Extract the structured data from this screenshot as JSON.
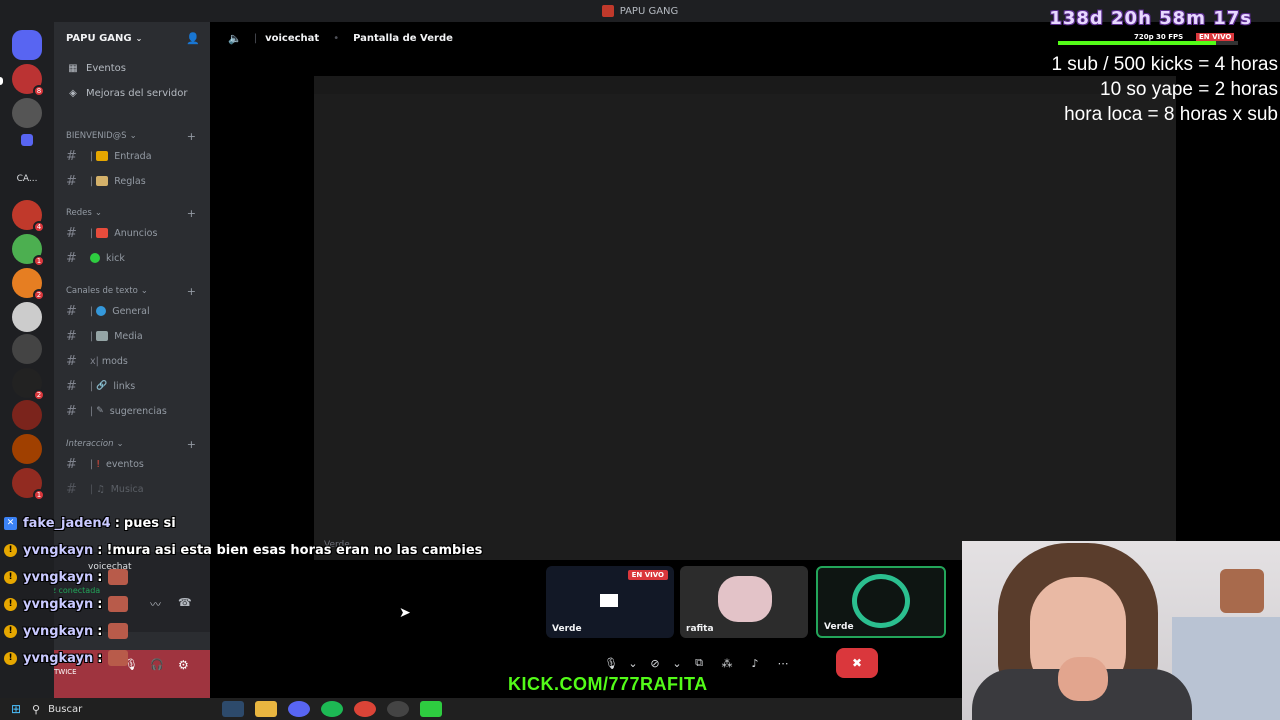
{
  "window": {
    "title": "PAPU GANG"
  },
  "server": {
    "name": "PAPU GANG",
    "top_items": [
      "Eventos",
      "Mejoras del servidor"
    ],
    "categories": [
      {
        "name": "BIENVENID@S",
        "channels": [
          "Entrada",
          "Reglas"
        ]
      },
      {
        "name": "Redes",
        "channels": [
          "Anuncios",
          "kick"
        ]
      },
      {
        "name": "Canales de texto",
        "channels": [
          "General",
          "Media",
          "mods",
          "links",
          "sugerencias"
        ]
      },
      {
        "name": "Interaccion",
        "channels": [
          "eventos",
          "Musica"
        ]
      }
    ],
    "rail": {
      "text_folder": "CA...",
      "badges": [
        "8",
        "",
        "4",
        "1",
        "2",
        "",
        "",
        "2",
        "",
        "",
        "1"
      ]
    }
  },
  "voice": {
    "channel": "voicechat",
    "screen_title": "Pantalla de Verde",
    "status": "Voz conectada",
    "user_label": "TWICE",
    "stream_tag": "Verde"
  },
  "tiles": [
    {
      "label": "Verde",
      "live": "EN VIVO"
    },
    {
      "label": "rafita"
    },
    {
      "label": "Verde"
    }
  ],
  "chat": [
    {
      "user": "fake_jaden4",
      "msg": "pues si",
      "badge": "blue"
    },
    {
      "user": "yvngkayn",
      "msg": "!mura asi esta bien esas horas eran no las cambies",
      "badge": "gold"
    },
    {
      "user": "yvngkayn",
      "msg": "",
      "badge": "gold"
    },
    {
      "user": "yvngkayn",
      "msg": "",
      "badge": "gold"
    },
    {
      "user": "yvngkayn",
      "msg": "",
      "badge": "gold"
    },
    {
      "user": "yvngkayn",
      "msg": "",
      "badge": "gold"
    }
  ],
  "overlay": {
    "timer": "138d 20h 58m 17s",
    "fps": "720p 30 FPS",
    "live": "EN VIVO",
    "progress": 0.88,
    "rules": [
      "1 sub / 500 kicks = 4 horas",
      "10 so yape = 2 horas",
      "hora loca = 8 horas x sub"
    ],
    "kick_url": "KICK.COM/777RAFITA"
  },
  "taskbar": {
    "search": "Buscar"
  },
  "colors": {
    "accent": "#53fc18",
    "danger": "#da373c",
    "sidebar": "#2b2d31",
    "rail": "#1e1f22"
  }
}
